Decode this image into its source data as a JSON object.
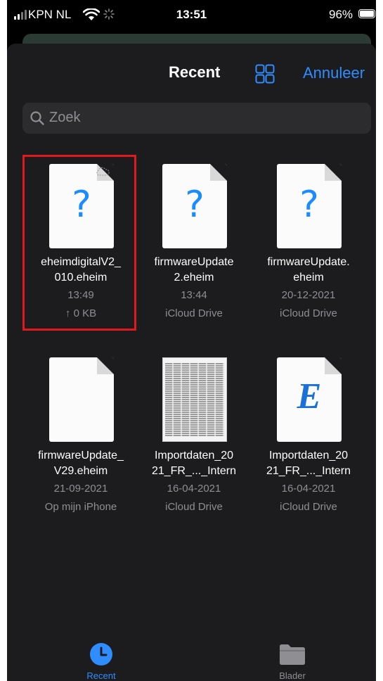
{
  "status_bar": {
    "carrier": "KPN NL",
    "time": "13:51",
    "battery": "96%"
  },
  "header": {
    "title": "Recent",
    "cancel_label": "Annuleer"
  },
  "search": {
    "placeholder": "Zoek"
  },
  "files": [
    {
      "name1": "eheimdigitalV2_",
      "name2": "010.eheim",
      "date": "13:49",
      "sub": "↑ 0 KB",
      "thumb": "question-doc-cloud"
    },
    {
      "name1": "firmwareUpdate",
      "name2": "2.eheim",
      "date": "13:44",
      "sub": "iCloud Drive",
      "thumb": "question-doc"
    },
    {
      "name1": "firmwareUpdate.",
      "name2": "eheim",
      "date": "20-12-2021",
      "sub": "iCloud Drive",
      "thumb": "question-doc"
    },
    {
      "name1": "firmwareUpdate_",
      "name2": "V29.eheim",
      "date": "21-09-2021",
      "sub": "Op mijn iPhone",
      "thumb": "blank-doc"
    },
    {
      "name1": "Importdaten_20",
      "name2": "21_FR_..._Intern",
      "date": "16-04-2021",
      "sub": "iCloud Drive",
      "thumb": "spreadsheet"
    },
    {
      "name1": "Importdaten_20",
      "name2": "21_FR_..._Intern",
      "date": "16-04-2021",
      "sub": "iCloud Drive",
      "thumb": "e-doc"
    }
  ],
  "tabs": [
    {
      "label": "Recent",
      "icon": "clock-icon",
      "active": true
    },
    {
      "label": "Blader",
      "icon": "folder-icon",
      "active": false
    }
  ],
  "colors": {
    "accent": "#2f8dff",
    "highlight": "#e0191e",
    "background": "#1c1c1e"
  }
}
